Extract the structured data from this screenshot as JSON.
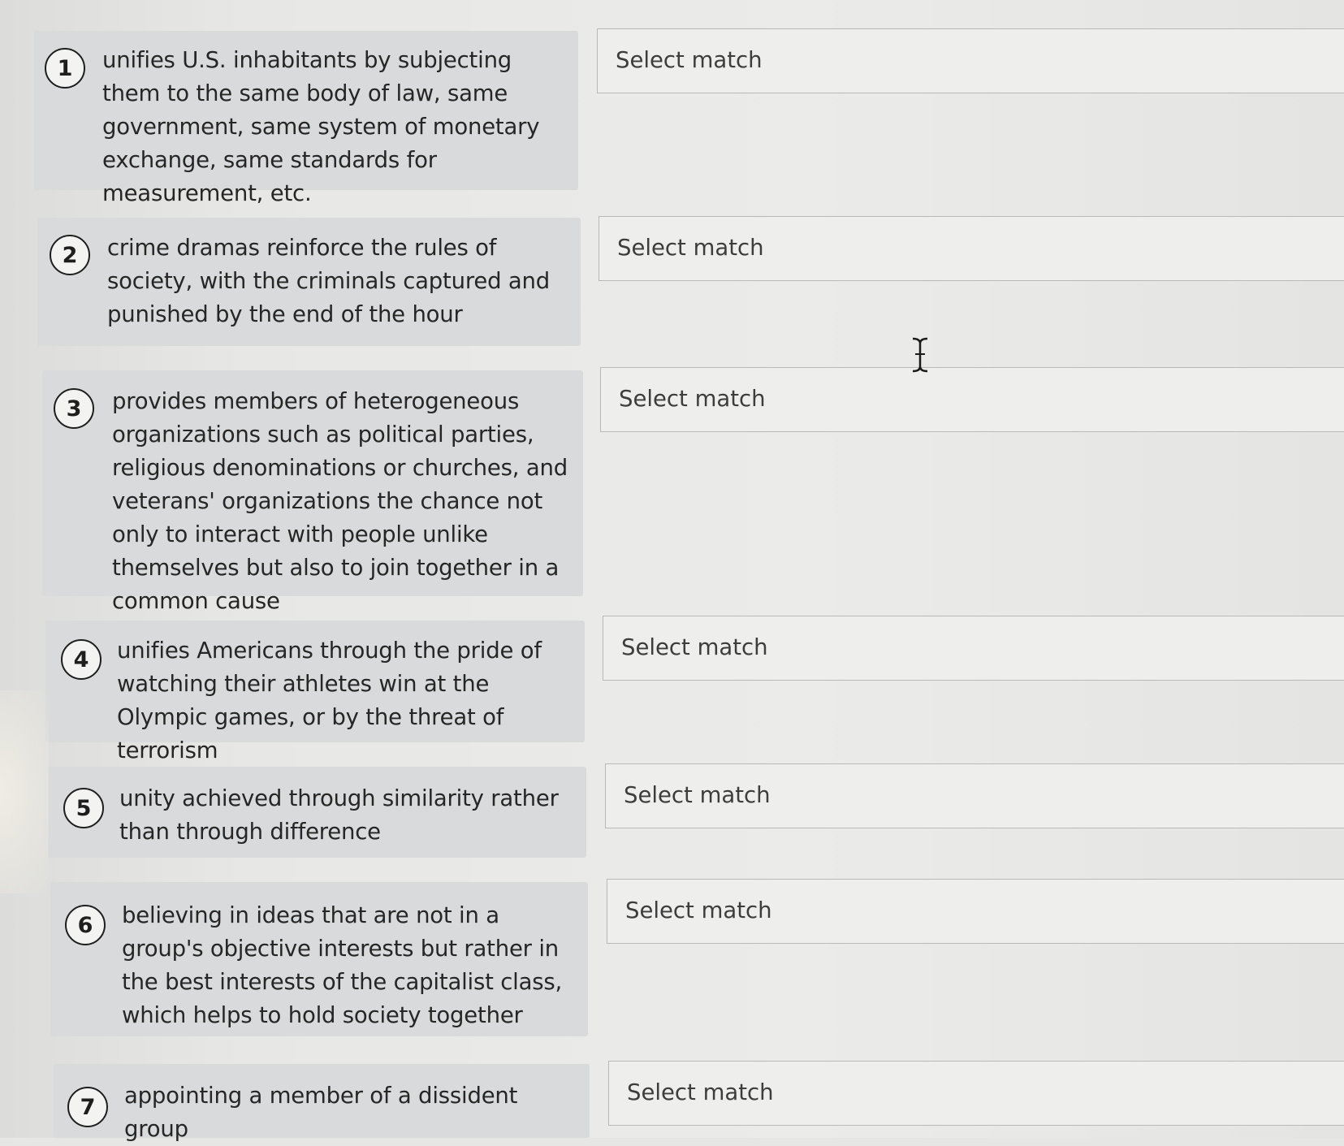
{
  "items": [
    {
      "number": "1",
      "prompt": "unifies U.S. inhabitants by subjecting them to the same body of law, same government, same system of monetary exchange, same standards for measurement, etc.",
      "select": "Select match"
    },
    {
      "number": "2",
      "prompt": "crime dramas reinforce the rules of society, with the criminals captured and punished by the end of the hour",
      "select": "Select match"
    },
    {
      "number": "3",
      "prompt": "provides members of heterogeneous organizations such as political parties, religious denominations or churches, and veterans' organizations the chance not only to interact with people unlike themselves but also to join together in a common cause",
      "select": "Select match"
    },
    {
      "number": "4",
      "prompt": "unifies Americans through the pride of watching their athletes win at the Olympic games, or by the threat of terrorism",
      "select": "Select match"
    },
    {
      "number": "5",
      "prompt": "unity achieved through similarity rather than through difference",
      "select": "Select match"
    },
    {
      "number": "6",
      "prompt": "believing in ideas that are not in a group's objective interests but rather in the best interests of the capitalist class, which helps to hold society together",
      "select": "Select match"
    },
    {
      "number": "7",
      "prompt": "appointing a member of a dissident group",
      "select": "Select match"
    }
  ],
  "cursor": {
    "icon": "text-cursor-icon"
  }
}
